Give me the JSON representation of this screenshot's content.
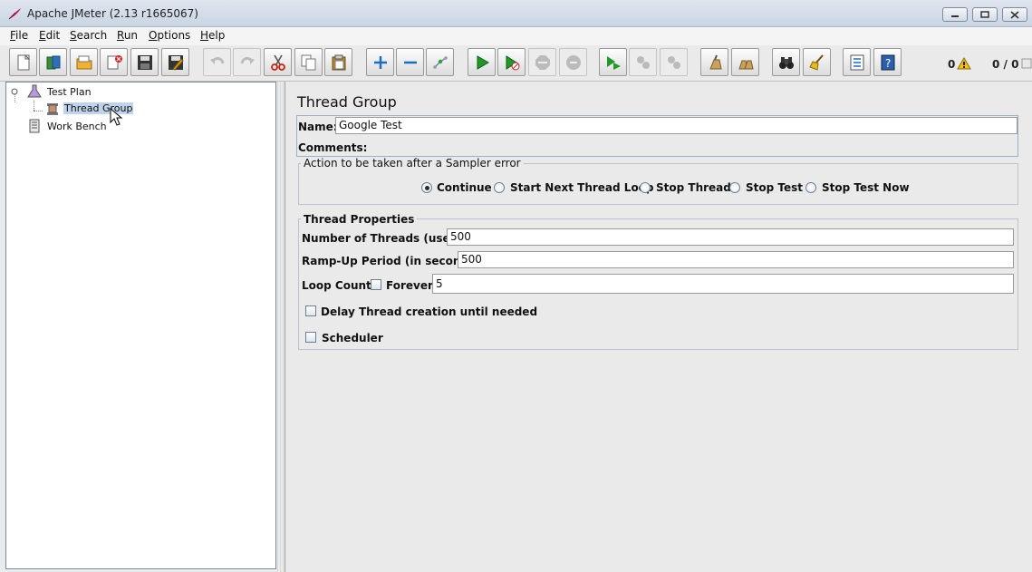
{
  "window": {
    "title": "Apache JMeter (2.13 r1665067)",
    "icon": "feather-icon"
  },
  "menubar": {
    "items": [
      {
        "label": "File",
        "mnemonic": "F",
        "rest": "ile"
      },
      {
        "label": "Edit",
        "mnemonic": "E",
        "rest": "dit"
      },
      {
        "label": "Search",
        "mnemonic": "S",
        "rest": "earch"
      },
      {
        "label": "Run",
        "mnemonic": "R",
        "rest": "un"
      },
      {
        "label": "Options",
        "mnemonic": "O",
        "rest": "ptions"
      },
      {
        "label": "Help",
        "mnemonic": "H",
        "rest": "elp"
      }
    ]
  },
  "toolbar": {
    "buttons": [
      "new-icon",
      "templates-icon",
      "open-icon",
      "close-icon",
      "save-icon",
      "save-as-icon",
      "undo-icon",
      "redo-icon",
      "cut-icon",
      "copy-icon",
      "paste-icon",
      "expand-icon",
      "collapse-icon",
      "toggle-icon",
      "start-icon",
      "start-no-pauses-icon",
      "stop-icon",
      "shutdown-icon",
      "remote-start-icon",
      "remote-stop-icon",
      "remote-exit-icon",
      "clear-icon",
      "clear-all-icon",
      "search-icon",
      "reset-search-icon",
      "function-helper-icon",
      "help-icon"
    ],
    "error_count": "0",
    "thread_count": "0 / 0"
  },
  "tree": {
    "test_plan": "Test Plan",
    "thread_group": "Thread Group",
    "work_bench": "Work Bench"
  },
  "panel": {
    "title": "Thread Group",
    "name_label": "Name:",
    "name_value": "Google Test",
    "comments_label": "Comments:",
    "error_action": {
      "legend": "Action to be taken after a Sampler error",
      "options": [
        "Continue",
        "Start Next Thread Loop",
        "Stop Thread",
        "Stop Test",
        "Stop Test Now"
      ],
      "selected": "Continue"
    },
    "thread_props": {
      "legend": "Thread Properties",
      "threads_label": "Number of Threads (users):",
      "threads_value": "500",
      "rampup_label": "Ramp-Up Period (in seconds):",
      "rampup_value": "500",
      "loop_label": "Loop Count:",
      "forever_label": "Forever",
      "loop_value": "5",
      "delay_label": "Delay Thread creation until needed",
      "scheduler_label": "Scheduler"
    }
  },
  "colors": {
    "selection": "#bfd4ea",
    "accent": "#1a6fc4"
  }
}
